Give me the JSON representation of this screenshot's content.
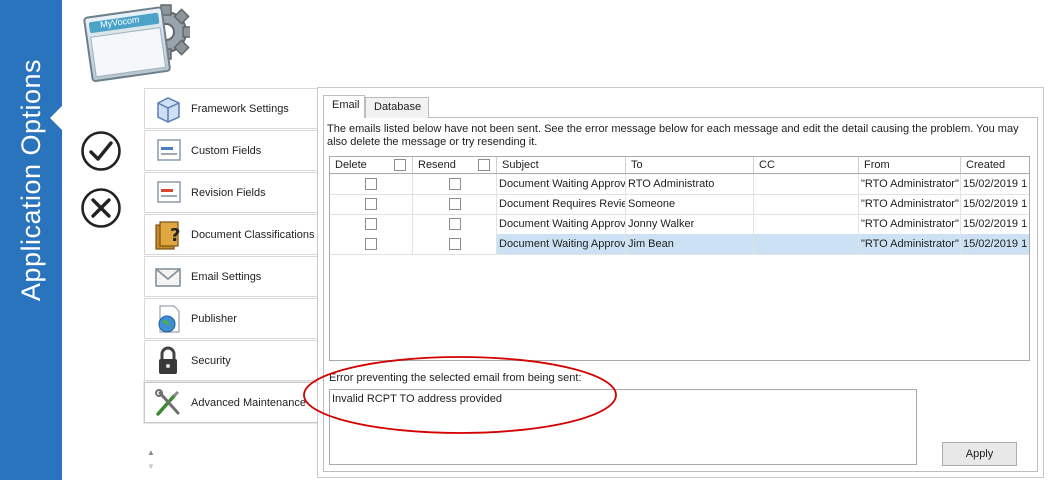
{
  "banner": {
    "title": "Application Options"
  },
  "logo": {
    "text": "MyVocom"
  },
  "actions": {
    "ok_icon": "check-circle-icon",
    "cancel_icon": "x-circle-icon"
  },
  "nav": {
    "items": [
      {
        "label": "Framework Settings",
        "icon": "framework-cube-icon"
      },
      {
        "label": "Custom Fields",
        "icon": "custom-fields-icon"
      },
      {
        "label": "Revision Fields",
        "icon": "revision-fields-icon"
      },
      {
        "label": "Document Classifications",
        "icon": "document-classifications-icon"
      },
      {
        "label": "Email Settings",
        "icon": "envelope-icon"
      },
      {
        "label": "Publisher",
        "icon": "publisher-globe-icon"
      },
      {
        "label": "Security",
        "icon": "padlock-icon"
      },
      {
        "label": "Advanced Maintenance",
        "icon": "tools-icon"
      }
    ],
    "selected": "Advanced Maintenance"
  },
  "tabs": [
    {
      "label": "Email",
      "active": true
    },
    {
      "label": "Database",
      "active": false
    }
  ],
  "info_text": "The emails listed below have not been sent. See the error message below for each message and edit the detail causing the problem. You may also delete the message or try resending it.",
  "grid": {
    "columns": [
      "Delete",
      "Resend",
      "Subject",
      "To",
      "CC",
      "From",
      "Created"
    ],
    "rows": [
      {
        "subject": "Document Waiting Approv",
        "to": "RTO Administrato",
        "cc": "",
        "from": "\"RTO Administrator\"",
        "created": "15/02/2019 1",
        "selected": false
      },
      {
        "subject": "Document Requires Revie",
        "to": "Someone",
        "cc": "",
        "from": "\"RTO Administrator\"",
        "created": "15/02/2019 1",
        "selected": false
      },
      {
        "subject": "Document Waiting Approv",
        "to": "Jonny Walker",
        "cc": "",
        "from": "\"RTO Administrator\"",
        "created": "15/02/2019 1",
        "selected": false
      },
      {
        "subject": "Document Waiting Approv",
        "to": "Jim Bean",
        "cc": "",
        "from": "\"RTO Administrator\"",
        "created": "15/02/2019 1",
        "selected": true
      }
    ]
  },
  "error": {
    "label": "Error preventing the selected email from being sent:",
    "message": "Invalid RCPT TO address provided"
  },
  "apply_label": "Apply",
  "colors": {
    "banner": "#2a74bd",
    "selected_row": "#cce2f4",
    "annotation": "#d40000"
  }
}
